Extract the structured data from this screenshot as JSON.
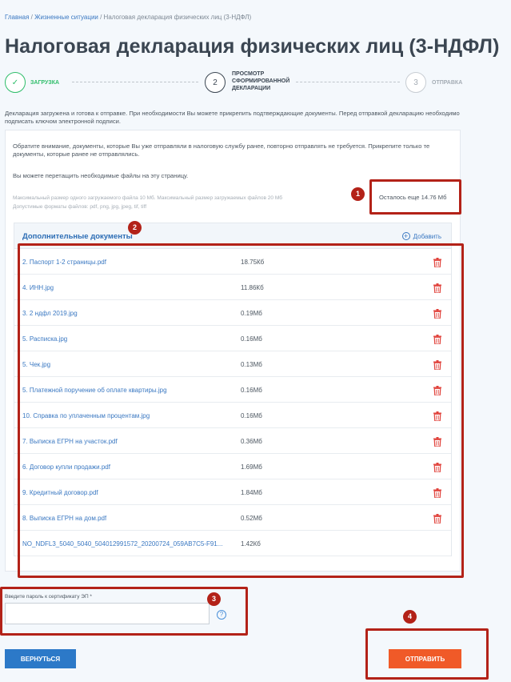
{
  "breadcrumb": {
    "home": "Главная",
    "sep1": " / ",
    "life": "Жизненные ситуации",
    "sep2": " / ",
    "current": "Налоговая декларация физических лиц (3-НДФЛ)"
  },
  "page_title": "Налоговая декларация физических лиц (3-НДФЛ)",
  "steps": [
    {
      "num": "✓",
      "label": "Загрузка",
      "status": "done"
    },
    {
      "num": "2",
      "label": "Просмотр сформированной декларации",
      "status": "active"
    },
    {
      "num": "3",
      "label": "Отправка",
      "status": "pending"
    }
  ],
  "intro_text": "Декларация загружена и готова к отправке. При необходимости Вы можете прикрепить подтверждающие документы. Перед отправкой декларацию необходимо подписать ключом электронной подписи.",
  "info_text": "Обратите внимание, документы, которые Вы уже отправляли в налоговую службу ранее, повторно отправлять не требуется. Прикрепите только те документы, которые ранее не отправлялись.",
  "drag_text": "Вы можете перетащить необходимые файлы на эту страницу.",
  "limits_text": "Максимальный размер одного загружаемого файла 10 Мб. Максимальный размер загружаемых файлов 20 Мб",
  "formats_text": "Допустимые форматы файлов: pdf, png, jpg, jpeg, tif, tiff",
  "remaining_text": "Осталось еще 14.76 Мб",
  "docs": {
    "title": "Дополнительные документы",
    "add_label": "Добавить",
    "files": [
      {
        "name": "2. Паспорт 1-2 страницы.pdf",
        "size": "18.75Кб",
        "deletable": true
      },
      {
        "name": "4. ИНН.jpg",
        "size": "11.86Кб",
        "deletable": true
      },
      {
        "name": "3. 2 ндфл 2019.jpg",
        "size": "0.19Мб",
        "deletable": true
      },
      {
        "name": "5. Расписка.jpg",
        "size": "0.16Мб",
        "deletable": true
      },
      {
        "name": "5. Чек.jpg",
        "size": "0.13Мб",
        "deletable": true
      },
      {
        "name": "5. Платежной поручение об оплате квартиры.jpg",
        "size": "0.16Мб",
        "deletable": true
      },
      {
        "name": "10. Справка по уплаченным процентам.jpg",
        "size": "0.16Мб",
        "deletable": true
      },
      {
        "name": "7. Выписка ЕГРН на участок.pdf",
        "size": "0.36Мб",
        "deletable": true
      },
      {
        "name": "6. Договор купли продажи.pdf",
        "size": "1.69Мб",
        "deletable": true
      },
      {
        "name": "9. Кредитный договор.pdf",
        "size": "1.84Мб",
        "deletable": true
      },
      {
        "name": "8. Выписка ЕГРН на дом.pdf",
        "size": "0.52Мб",
        "deletable": true
      },
      {
        "name": "NO_NDFL3_5040_5040_504012991572_20200724_059AB7C5-F91...",
        "size": "1.42Кб",
        "deletable": false
      }
    ]
  },
  "password": {
    "label": "Введите пароль к сертификату ЭП *",
    "value": "",
    "help": "?"
  },
  "buttons": {
    "back": "Вернуться",
    "send": "Отправить"
  },
  "markers": [
    "1",
    "2",
    "3",
    "4"
  ],
  "colors": {
    "accent": "#2c79c8",
    "send": "#f05a28",
    "success": "#2fbd6a",
    "annotation": "#b32218",
    "delete": "#e0413a"
  }
}
